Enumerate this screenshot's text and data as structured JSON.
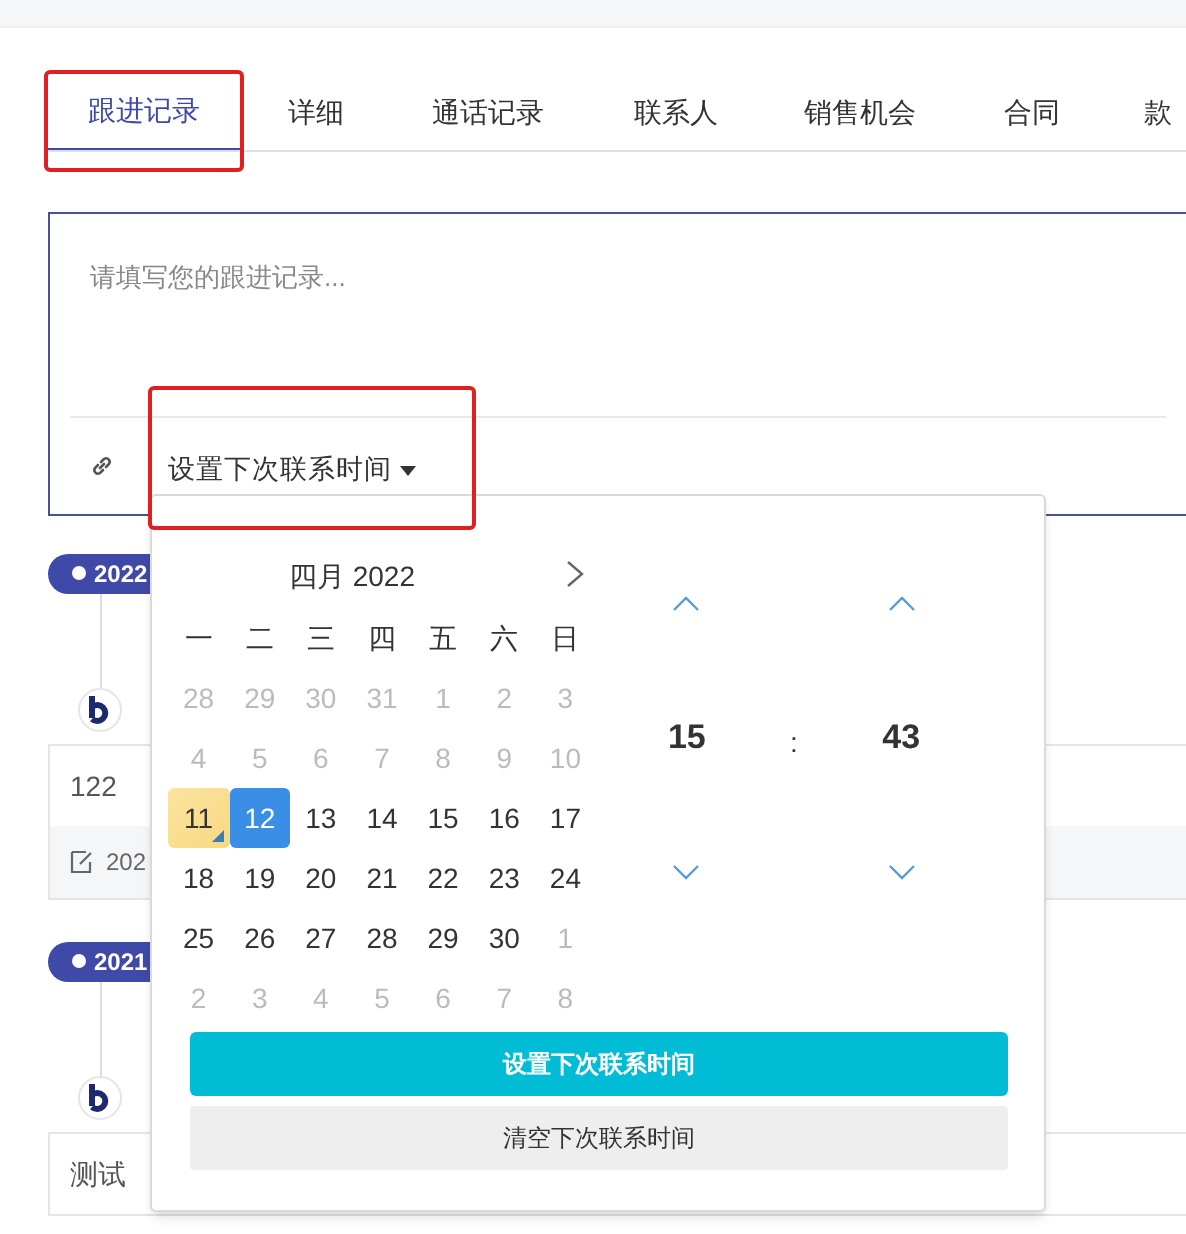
{
  "tabs": [
    {
      "label": "跟进记录",
      "selected": true
    },
    {
      "label": "详细",
      "selected": false
    },
    {
      "label": "通话记录",
      "selected": false
    },
    {
      "label": "联系人",
      "selected": false
    },
    {
      "label": "销售机会",
      "selected": false
    },
    {
      "label": "合同",
      "selected": false
    },
    {
      "label": "款",
      "selected": false
    }
  ],
  "editor": {
    "placeholder": "请填写您的跟进记录...",
    "next_contact_dropdown": "设置下次联系时间"
  },
  "timeline": [
    {
      "badge": "2022",
      "content": "122",
      "date": "202"
    },
    {
      "badge": "2021",
      "content": "测试"
    }
  ],
  "picker": {
    "month_title": "四月 2022",
    "weekdays": [
      "一",
      "二",
      "三",
      "四",
      "五",
      "六",
      "日"
    ],
    "days": [
      {
        "label": "28",
        "outside": true,
        "today": false,
        "selected": false
      },
      {
        "label": "29",
        "outside": true,
        "today": false,
        "selected": false
      },
      {
        "label": "30",
        "outside": true,
        "today": false,
        "selected": false
      },
      {
        "label": "31",
        "outside": true,
        "today": false,
        "selected": false
      },
      {
        "label": "1",
        "outside": true,
        "today": false,
        "selected": false
      },
      {
        "label": "2",
        "outside": true,
        "today": false,
        "selected": false
      },
      {
        "label": "3",
        "outside": true,
        "today": false,
        "selected": false
      },
      {
        "label": "4",
        "outside": true,
        "today": false,
        "selected": false
      },
      {
        "label": "5",
        "outside": true,
        "today": false,
        "selected": false
      },
      {
        "label": "6",
        "outside": true,
        "today": false,
        "selected": false
      },
      {
        "label": "7",
        "outside": true,
        "today": false,
        "selected": false
      },
      {
        "label": "8",
        "outside": true,
        "today": false,
        "selected": false
      },
      {
        "label": "9",
        "outside": true,
        "today": false,
        "selected": false
      },
      {
        "label": "10",
        "outside": true,
        "today": false,
        "selected": false
      },
      {
        "label": "11",
        "outside": false,
        "today": true,
        "selected": false
      },
      {
        "label": "12",
        "outside": false,
        "today": false,
        "selected": true
      },
      {
        "label": "13",
        "outside": false,
        "today": false,
        "selected": false
      },
      {
        "label": "14",
        "outside": false,
        "today": false,
        "selected": false
      },
      {
        "label": "15",
        "outside": false,
        "today": false,
        "selected": false
      },
      {
        "label": "16",
        "outside": false,
        "today": false,
        "selected": false
      },
      {
        "label": "17",
        "outside": false,
        "today": false,
        "selected": false
      },
      {
        "label": "18",
        "outside": false,
        "today": false,
        "selected": false
      },
      {
        "label": "19",
        "outside": false,
        "today": false,
        "selected": false
      },
      {
        "label": "20",
        "outside": false,
        "today": false,
        "selected": false
      },
      {
        "label": "21",
        "outside": false,
        "today": false,
        "selected": false
      },
      {
        "label": "22",
        "outside": false,
        "today": false,
        "selected": false
      },
      {
        "label": "23",
        "outside": false,
        "today": false,
        "selected": false
      },
      {
        "label": "24",
        "outside": false,
        "today": false,
        "selected": false
      },
      {
        "label": "25",
        "outside": false,
        "today": false,
        "selected": false
      },
      {
        "label": "26",
        "outside": false,
        "today": false,
        "selected": false
      },
      {
        "label": "27",
        "outside": false,
        "today": false,
        "selected": false
      },
      {
        "label": "28",
        "outside": false,
        "today": false,
        "selected": false
      },
      {
        "label": "29",
        "outside": false,
        "today": false,
        "selected": false
      },
      {
        "label": "30",
        "outside": false,
        "today": false,
        "selected": false
      },
      {
        "label": "1",
        "outside": true,
        "today": false,
        "selected": false
      },
      {
        "label": "2",
        "outside": true,
        "today": false,
        "selected": false
      },
      {
        "label": "3",
        "outside": true,
        "today": false,
        "selected": false
      },
      {
        "label": "4",
        "outside": true,
        "today": false,
        "selected": false
      },
      {
        "label": "5",
        "outside": true,
        "today": false,
        "selected": false
      },
      {
        "label": "6",
        "outside": true,
        "today": false,
        "selected": false
      },
      {
        "label": "7",
        "outside": true,
        "today": false,
        "selected": false
      },
      {
        "label": "8",
        "outside": true,
        "today": false,
        "selected": false
      }
    ],
    "hour": "15",
    "separator": ":",
    "minute": "43",
    "buttons": [
      {
        "kind": "primary",
        "label": "设置下次联系时间"
      },
      {
        "kind": "secondary",
        "label": "清空下次联系时间"
      }
    ]
  }
}
